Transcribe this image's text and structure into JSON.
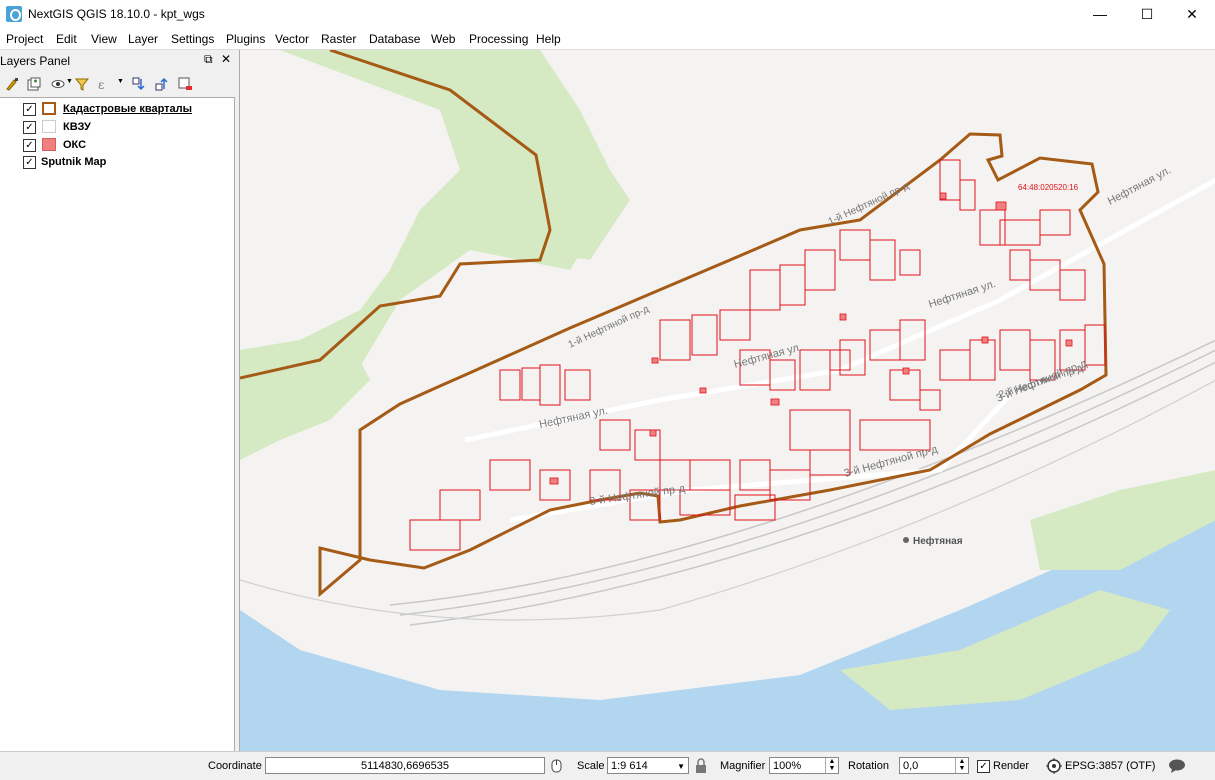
{
  "window": {
    "title": "NextGIS QGIS 18.10.0 - kpt_wgs",
    "minimize": "—",
    "maximize": "☐",
    "close": "✕"
  },
  "menu": [
    {
      "label": "Project"
    },
    {
      "label": "Edit"
    },
    {
      "label": "View"
    },
    {
      "label": "Layer"
    },
    {
      "label": "Settings"
    },
    {
      "label": "Plugins"
    },
    {
      "label": "Vector"
    },
    {
      "label": "Raster"
    },
    {
      "label": "Database"
    },
    {
      "label": "Web"
    },
    {
      "label": "Processing"
    },
    {
      "label": "Help"
    }
  ],
  "layers_panel": {
    "title": "Layers Panel",
    "float_btn": "⧉",
    "close_btn": "✕",
    "layers": [
      {
        "name": "Кадастровые кварталы",
        "checked": "✓",
        "symbol_color": "#a55a16"
      },
      {
        "name": "КВЗУ",
        "checked": "✓",
        "symbol_color": "#ffffff"
      },
      {
        "name": "ОКС",
        "checked": "✓",
        "symbol_color": "#f08080"
      },
      {
        "name": "Sputnik Map",
        "checked": "✓",
        "symbol_color": ""
      }
    ]
  },
  "map": {
    "labels": {
      "cadastral_id": "64:48:020520:16",
      "street1a": "Нефтяная ул.",
      "street1b": "Нефтяная ул.",
      "street1c": "Нефтяная ул.",
      "street1d": "Нефтяная ул.",
      "proezd1a": "1-й Нефтяной пр-д",
      "proezd1b": "1-й Нефтяной пр-д",
      "proezd2": "2-й Нефтяной пр-д",
      "proezd3a": "3-й Нефтяной пр-д",
      "proezd3b": "3-й Нефтяной пр-д",
      "proezd3c": "3-й Нефтяной пр-д",
      "station": "Нефтяная"
    },
    "colors": {
      "boundary": "#a55a16",
      "parcel": "#e0101a",
      "building": "#f08080",
      "water": "#b3d6f0",
      "green": "#d5e9c2"
    }
  },
  "status": {
    "coordinate_label": "Coordinate",
    "coordinate_value": "5114830,6696535",
    "scale_label": "Scale",
    "scale_value": "1:9 614",
    "magnifier_label": "Magnifier",
    "magnifier_value": "100%",
    "rotation_label": "Rotation",
    "rotation_value": "0,0",
    "render_label": "Render",
    "render_checked": "✓",
    "crs": "EPSG:3857 (OTF)"
  }
}
